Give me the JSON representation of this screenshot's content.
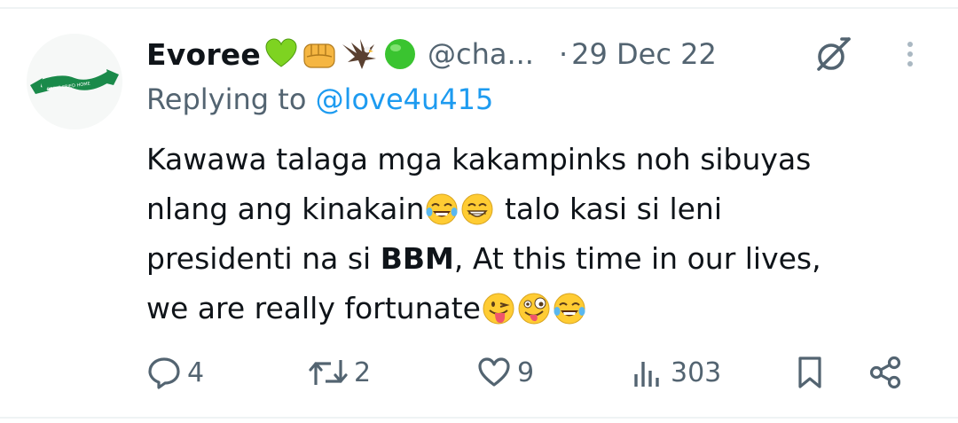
{
  "tweet": {
    "display_name": "Evoree",
    "name_emojis": [
      "green-heart-emoji",
      "oncoming-fist-emoji",
      "eagle-emoji",
      "green-circle-emoji"
    ],
    "handle": "@cha...",
    "separator": "·",
    "date": "29 Dec 22",
    "replying_prefix": "Replying to ",
    "replying_to": "@love4u415",
    "avatar_banner_text": "BRING FRIED HOME",
    "text": {
      "line1": "Kawawa talaga mga kakampinks noh sibuyas",
      "line2_a": "nlang ang kinakain",
      "line2_b": " talo kasi si leni",
      "line3_a": "presidenti na si ",
      "line3_bold": "BBM",
      "line3_b": ", At this time in our lives,",
      "line4_a": "we are really fortunate"
    }
  },
  "actions": {
    "replies": "4",
    "reposts": "2",
    "likes": "9",
    "views": "303"
  },
  "icons": {
    "grok": "grok-icon",
    "more": "more-options-icon",
    "reply": "reply-icon",
    "repost": "repost-icon",
    "like": "heart-icon",
    "views": "views-icon",
    "bookmark": "bookmark-icon",
    "share": "share-icon"
  },
  "colors": {
    "text": "#0f1419",
    "secondary": "#536471",
    "link": "#1d9bf0",
    "divider": "#eff3f4",
    "avatar_ribbon": "#1a8a4a"
  }
}
